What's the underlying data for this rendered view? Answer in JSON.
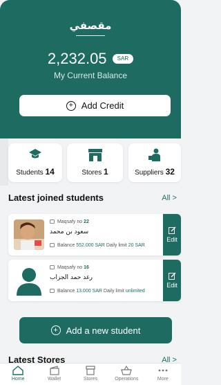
{
  "header": {
    "brand": "مقصفي",
    "balance_amount": "2,232.05",
    "currency": "SAR",
    "balance_caption": "My Current Balance",
    "add_credit_label": "Add Credit"
  },
  "stats": [
    {
      "label": "Students",
      "count": "14",
      "icon": "graduation-cap-icon"
    },
    {
      "label": "Stores",
      "count": "1",
      "icon": "store-icon"
    },
    {
      "label": "Suppliers",
      "count": "32",
      "icon": "supplier-icon"
    }
  ],
  "latest_students": {
    "title": "Latest joined students",
    "all_label": "All >",
    "items": [
      {
        "maqsafy_label": "Maqsafy no",
        "maqsafy_no": "22",
        "name": "سعود بن محمد",
        "balance_label": "Balance",
        "balance": "552.000 SAR",
        "daily_limit_label": "Daily limit",
        "daily_limit": "20 SAR",
        "edit_label": "Edit",
        "avatar": "photo"
      },
      {
        "maqsafy_label": "Maqsafy no",
        "maqsafy_no": "16",
        "name": "رغد حمد الجزاب",
        "balance_label": "Balance",
        "balance": "13.000 SAR",
        "daily_limit_label": "Daily limit",
        "daily_limit": "unlimited",
        "edit_label": "Edit",
        "avatar": "default-user-icon"
      }
    ]
  },
  "add_student_label": "Add a new student",
  "latest_stores": {
    "title": "Latest Stores",
    "all_label": "All >"
  },
  "bottom_nav": [
    {
      "label": "Home",
      "icon": "home-icon",
      "active": true
    },
    {
      "label": "Wallet",
      "icon": "wallet-icon",
      "active": false
    },
    {
      "label": "Stores",
      "icon": "store-icon",
      "active": false
    },
    {
      "label": "Operations",
      "icon": "operations-icon",
      "active": false
    },
    {
      "label": "More",
      "icon": "more-icon",
      "active": false
    }
  ],
  "colors": {
    "primary": "#1e6b61",
    "background": "#f2f3f4",
    "card": "#ffffff"
  }
}
